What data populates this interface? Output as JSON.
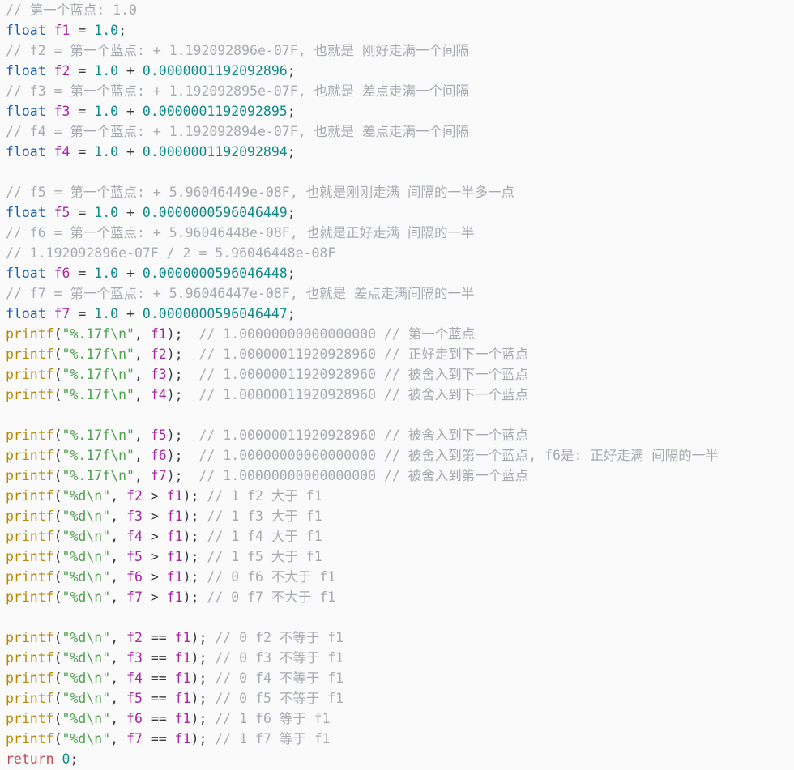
{
  "colors": {
    "background": "#fafafa",
    "comment": "#a7aab0",
    "type_keyword": "#1a5fb4",
    "variable": "#a626a4",
    "number": "#0e8a8a",
    "function": "#b58900",
    "string": "#50a14f",
    "return_keyword": "#c5474f"
  },
  "lines": [
    [
      {
        "t": "comment",
        "v": "// 第一个蓝点: 1.0"
      }
    ],
    [
      {
        "t": "type",
        "v": "float"
      },
      {
        "t": "op",
        "v": " "
      },
      {
        "t": "var",
        "v": "f1"
      },
      {
        "t": "op",
        "v": " = "
      },
      {
        "t": "num",
        "v": "1.0"
      },
      {
        "t": "op",
        "v": ";"
      }
    ],
    [
      {
        "t": "comment",
        "v": "// f2 = 第一个蓝点: + 1.192092896e-07F, 也就是 刚好走满一个间隔"
      }
    ],
    [
      {
        "t": "type",
        "v": "float"
      },
      {
        "t": "op",
        "v": " "
      },
      {
        "t": "var",
        "v": "f2"
      },
      {
        "t": "op",
        "v": " = "
      },
      {
        "t": "num",
        "v": "1.0"
      },
      {
        "t": "op",
        "v": " + "
      },
      {
        "t": "num",
        "v": "0.0000001192092896"
      },
      {
        "t": "op",
        "v": ";"
      }
    ],
    [
      {
        "t": "comment",
        "v": "// f3 = 第一个蓝点: + 1.192092895e-07F, 也就是 差点走满一个间隔"
      }
    ],
    [
      {
        "t": "type",
        "v": "float"
      },
      {
        "t": "op",
        "v": " "
      },
      {
        "t": "var",
        "v": "f3"
      },
      {
        "t": "op",
        "v": " = "
      },
      {
        "t": "num",
        "v": "1.0"
      },
      {
        "t": "op",
        "v": " + "
      },
      {
        "t": "num",
        "v": "0.0000001192092895"
      },
      {
        "t": "op",
        "v": ";"
      }
    ],
    [
      {
        "t": "comment",
        "v": "// f4 = 第一个蓝点: + 1.192092894e-07F, 也就是 差点走满一个间隔"
      }
    ],
    [
      {
        "t": "type",
        "v": "float"
      },
      {
        "t": "op",
        "v": " "
      },
      {
        "t": "var",
        "v": "f4"
      },
      {
        "t": "op",
        "v": " = "
      },
      {
        "t": "num",
        "v": "1.0"
      },
      {
        "t": "op",
        "v": " + "
      },
      {
        "t": "num",
        "v": "0.0000001192092894"
      },
      {
        "t": "op",
        "v": ";"
      }
    ],
    [],
    [
      {
        "t": "comment",
        "v": "// f5 = 第一个蓝点: + 5.96046449e-08F, 也就是刚刚走满 间隔的一半多一点"
      }
    ],
    [
      {
        "t": "type",
        "v": "float"
      },
      {
        "t": "op",
        "v": " "
      },
      {
        "t": "var",
        "v": "f5"
      },
      {
        "t": "op",
        "v": " = "
      },
      {
        "t": "num",
        "v": "1.0"
      },
      {
        "t": "op",
        "v": " + "
      },
      {
        "t": "num",
        "v": "0.0000000596046449"
      },
      {
        "t": "op",
        "v": ";"
      }
    ],
    [
      {
        "t": "comment",
        "v": "// f6 = 第一个蓝点: + 5.96046448e-08F, 也就是正好走满 间隔的一半"
      }
    ],
    [
      {
        "t": "comment",
        "v": "// 1.192092896e-07F / 2 = 5.96046448e-08F"
      }
    ],
    [
      {
        "t": "type",
        "v": "float"
      },
      {
        "t": "op",
        "v": " "
      },
      {
        "t": "var",
        "v": "f6"
      },
      {
        "t": "op",
        "v": " = "
      },
      {
        "t": "num",
        "v": "1.0"
      },
      {
        "t": "op",
        "v": " + "
      },
      {
        "t": "num",
        "v": "0.0000000596046448"
      },
      {
        "t": "op",
        "v": ";"
      }
    ],
    [
      {
        "t": "comment",
        "v": "// f7 = 第一个蓝点: + 5.96046447e-08F, 也就是 差点走满间隔的一半"
      }
    ],
    [
      {
        "t": "type",
        "v": "float"
      },
      {
        "t": "op",
        "v": " "
      },
      {
        "t": "var",
        "v": "f7"
      },
      {
        "t": "op",
        "v": " = "
      },
      {
        "t": "num",
        "v": "1.0"
      },
      {
        "t": "op",
        "v": " + "
      },
      {
        "t": "num",
        "v": "0.0000000596046447"
      },
      {
        "t": "op",
        "v": ";"
      }
    ],
    [
      {
        "t": "fn",
        "v": "printf"
      },
      {
        "t": "op",
        "v": "("
      },
      {
        "t": "str",
        "v": "\"%.17f\\n\""
      },
      {
        "t": "op",
        "v": ", "
      },
      {
        "t": "var",
        "v": "f1"
      },
      {
        "t": "op",
        "v": ");  "
      },
      {
        "t": "comment",
        "v": "// 1.00000000000000000 // 第一个蓝点"
      }
    ],
    [
      {
        "t": "fn",
        "v": "printf"
      },
      {
        "t": "op",
        "v": "("
      },
      {
        "t": "str",
        "v": "\"%.17f\\n\""
      },
      {
        "t": "op",
        "v": ", "
      },
      {
        "t": "var",
        "v": "f2"
      },
      {
        "t": "op",
        "v": ");  "
      },
      {
        "t": "comment",
        "v": "// 1.00000011920928960 // 正好走到下一个蓝点"
      }
    ],
    [
      {
        "t": "fn",
        "v": "printf"
      },
      {
        "t": "op",
        "v": "("
      },
      {
        "t": "str",
        "v": "\"%.17f\\n\""
      },
      {
        "t": "op",
        "v": ", "
      },
      {
        "t": "var",
        "v": "f3"
      },
      {
        "t": "op",
        "v": ");  "
      },
      {
        "t": "comment",
        "v": "// 1.00000011920928960 // 被舍入到下一个蓝点"
      }
    ],
    [
      {
        "t": "fn",
        "v": "printf"
      },
      {
        "t": "op",
        "v": "("
      },
      {
        "t": "str",
        "v": "\"%.17f\\n\""
      },
      {
        "t": "op",
        "v": ", "
      },
      {
        "t": "var",
        "v": "f4"
      },
      {
        "t": "op",
        "v": ");  "
      },
      {
        "t": "comment",
        "v": "// 1.00000011920928960 // 被舍入到下一个蓝点"
      }
    ],
    [],
    [
      {
        "t": "fn",
        "v": "printf"
      },
      {
        "t": "op",
        "v": "("
      },
      {
        "t": "str",
        "v": "\"%.17f\\n\""
      },
      {
        "t": "op",
        "v": ", "
      },
      {
        "t": "var",
        "v": "f5"
      },
      {
        "t": "op",
        "v": ");  "
      },
      {
        "t": "comment",
        "v": "// 1.00000011920928960 // 被舍入到下一个蓝点"
      }
    ],
    [
      {
        "t": "fn",
        "v": "printf"
      },
      {
        "t": "op",
        "v": "("
      },
      {
        "t": "str",
        "v": "\"%.17f\\n\""
      },
      {
        "t": "op",
        "v": ", "
      },
      {
        "t": "var",
        "v": "f6"
      },
      {
        "t": "op",
        "v": ");  "
      },
      {
        "t": "comment",
        "v": "// 1.00000000000000000 // 被舍入到第一个蓝点, f6是: 正好走满 间隔的一半"
      }
    ],
    [
      {
        "t": "fn",
        "v": "printf"
      },
      {
        "t": "op",
        "v": "("
      },
      {
        "t": "str",
        "v": "\"%.17f\\n\""
      },
      {
        "t": "op",
        "v": ", "
      },
      {
        "t": "var",
        "v": "f7"
      },
      {
        "t": "op",
        "v": ");  "
      },
      {
        "t": "comment",
        "v": "// 1.00000000000000000 // 被舍入到第一个蓝点"
      }
    ],
    [
      {
        "t": "fn",
        "v": "printf"
      },
      {
        "t": "op",
        "v": "("
      },
      {
        "t": "str",
        "v": "\"%d\\n\""
      },
      {
        "t": "op",
        "v": ", "
      },
      {
        "t": "var",
        "v": "f2"
      },
      {
        "t": "op",
        "v": " > "
      },
      {
        "t": "var",
        "v": "f1"
      },
      {
        "t": "op",
        "v": "); "
      },
      {
        "t": "comment",
        "v": "// 1 f2 大于 f1"
      }
    ],
    [
      {
        "t": "fn",
        "v": "printf"
      },
      {
        "t": "op",
        "v": "("
      },
      {
        "t": "str",
        "v": "\"%d\\n\""
      },
      {
        "t": "op",
        "v": ", "
      },
      {
        "t": "var",
        "v": "f3"
      },
      {
        "t": "op",
        "v": " > "
      },
      {
        "t": "var",
        "v": "f1"
      },
      {
        "t": "op",
        "v": "); "
      },
      {
        "t": "comment",
        "v": "// 1 f3 大于 f1"
      }
    ],
    [
      {
        "t": "fn",
        "v": "printf"
      },
      {
        "t": "op",
        "v": "("
      },
      {
        "t": "str",
        "v": "\"%d\\n\""
      },
      {
        "t": "op",
        "v": ", "
      },
      {
        "t": "var",
        "v": "f4"
      },
      {
        "t": "op",
        "v": " > "
      },
      {
        "t": "var",
        "v": "f1"
      },
      {
        "t": "op",
        "v": "); "
      },
      {
        "t": "comment",
        "v": "// 1 f4 大于 f1"
      }
    ],
    [
      {
        "t": "fn",
        "v": "printf"
      },
      {
        "t": "op",
        "v": "("
      },
      {
        "t": "str",
        "v": "\"%d\\n\""
      },
      {
        "t": "op",
        "v": ", "
      },
      {
        "t": "var",
        "v": "f5"
      },
      {
        "t": "op",
        "v": " > "
      },
      {
        "t": "var",
        "v": "f1"
      },
      {
        "t": "op",
        "v": "); "
      },
      {
        "t": "comment",
        "v": "// 1 f5 大于 f1"
      }
    ],
    [
      {
        "t": "fn",
        "v": "printf"
      },
      {
        "t": "op",
        "v": "("
      },
      {
        "t": "str",
        "v": "\"%d\\n\""
      },
      {
        "t": "op",
        "v": ", "
      },
      {
        "t": "var",
        "v": "f6"
      },
      {
        "t": "op",
        "v": " > "
      },
      {
        "t": "var",
        "v": "f1"
      },
      {
        "t": "op",
        "v": "); "
      },
      {
        "t": "comment",
        "v": "// 0 f6 不大于 f1"
      }
    ],
    [
      {
        "t": "fn",
        "v": "printf"
      },
      {
        "t": "op",
        "v": "("
      },
      {
        "t": "str",
        "v": "\"%d\\n\""
      },
      {
        "t": "op",
        "v": ", "
      },
      {
        "t": "var",
        "v": "f7"
      },
      {
        "t": "op",
        "v": " > "
      },
      {
        "t": "var",
        "v": "f1"
      },
      {
        "t": "op",
        "v": "); "
      },
      {
        "t": "comment",
        "v": "// 0 f7 不大于 f1"
      }
    ],
    [],
    [
      {
        "t": "fn",
        "v": "printf"
      },
      {
        "t": "op",
        "v": "("
      },
      {
        "t": "str",
        "v": "\"%d\\n\""
      },
      {
        "t": "op",
        "v": ", "
      },
      {
        "t": "var",
        "v": "f2"
      },
      {
        "t": "op",
        "v": " == "
      },
      {
        "t": "var",
        "v": "f1"
      },
      {
        "t": "op",
        "v": "); "
      },
      {
        "t": "comment",
        "v": "// 0 f2 不等于 f1"
      }
    ],
    [
      {
        "t": "fn",
        "v": "printf"
      },
      {
        "t": "op",
        "v": "("
      },
      {
        "t": "str",
        "v": "\"%d\\n\""
      },
      {
        "t": "op",
        "v": ", "
      },
      {
        "t": "var",
        "v": "f3"
      },
      {
        "t": "op",
        "v": " == "
      },
      {
        "t": "var",
        "v": "f1"
      },
      {
        "t": "op",
        "v": "); "
      },
      {
        "t": "comment",
        "v": "// 0 f3 不等于 f1"
      }
    ],
    [
      {
        "t": "fn",
        "v": "printf"
      },
      {
        "t": "op",
        "v": "("
      },
      {
        "t": "str",
        "v": "\"%d\\n\""
      },
      {
        "t": "op",
        "v": ", "
      },
      {
        "t": "var",
        "v": "f4"
      },
      {
        "t": "op",
        "v": " == "
      },
      {
        "t": "var",
        "v": "f1"
      },
      {
        "t": "op",
        "v": "); "
      },
      {
        "t": "comment",
        "v": "// 0 f4 不等于 f1"
      }
    ],
    [
      {
        "t": "fn",
        "v": "printf"
      },
      {
        "t": "op",
        "v": "("
      },
      {
        "t": "str",
        "v": "\"%d\\n\""
      },
      {
        "t": "op",
        "v": ", "
      },
      {
        "t": "var",
        "v": "f5"
      },
      {
        "t": "op",
        "v": " == "
      },
      {
        "t": "var",
        "v": "f1"
      },
      {
        "t": "op",
        "v": "); "
      },
      {
        "t": "comment",
        "v": "// 0 f5 不等于 f1"
      }
    ],
    [
      {
        "t": "fn",
        "v": "printf"
      },
      {
        "t": "op",
        "v": "("
      },
      {
        "t": "str",
        "v": "\"%d\\n\""
      },
      {
        "t": "op",
        "v": ", "
      },
      {
        "t": "var",
        "v": "f6"
      },
      {
        "t": "op",
        "v": " == "
      },
      {
        "t": "var",
        "v": "f1"
      },
      {
        "t": "op",
        "v": "); "
      },
      {
        "t": "comment",
        "v": "// 1 f6 等于 f1"
      }
    ],
    [
      {
        "t": "fn",
        "v": "printf"
      },
      {
        "t": "op",
        "v": "("
      },
      {
        "t": "str",
        "v": "\"%d\\n\""
      },
      {
        "t": "op",
        "v": ", "
      },
      {
        "t": "var",
        "v": "f7"
      },
      {
        "t": "op",
        "v": " == "
      },
      {
        "t": "var",
        "v": "f1"
      },
      {
        "t": "op",
        "v": "); "
      },
      {
        "t": "comment",
        "v": "// 1 f7 等于 f1"
      }
    ],
    [
      {
        "t": "kw",
        "v": "return"
      },
      {
        "t": "op",
        "v": " "
      },
      {
        "t": "num",
        "v": "0"
      },
      {
        "t": "op",
        "v": ";"
      }
    ]
  ]
}
